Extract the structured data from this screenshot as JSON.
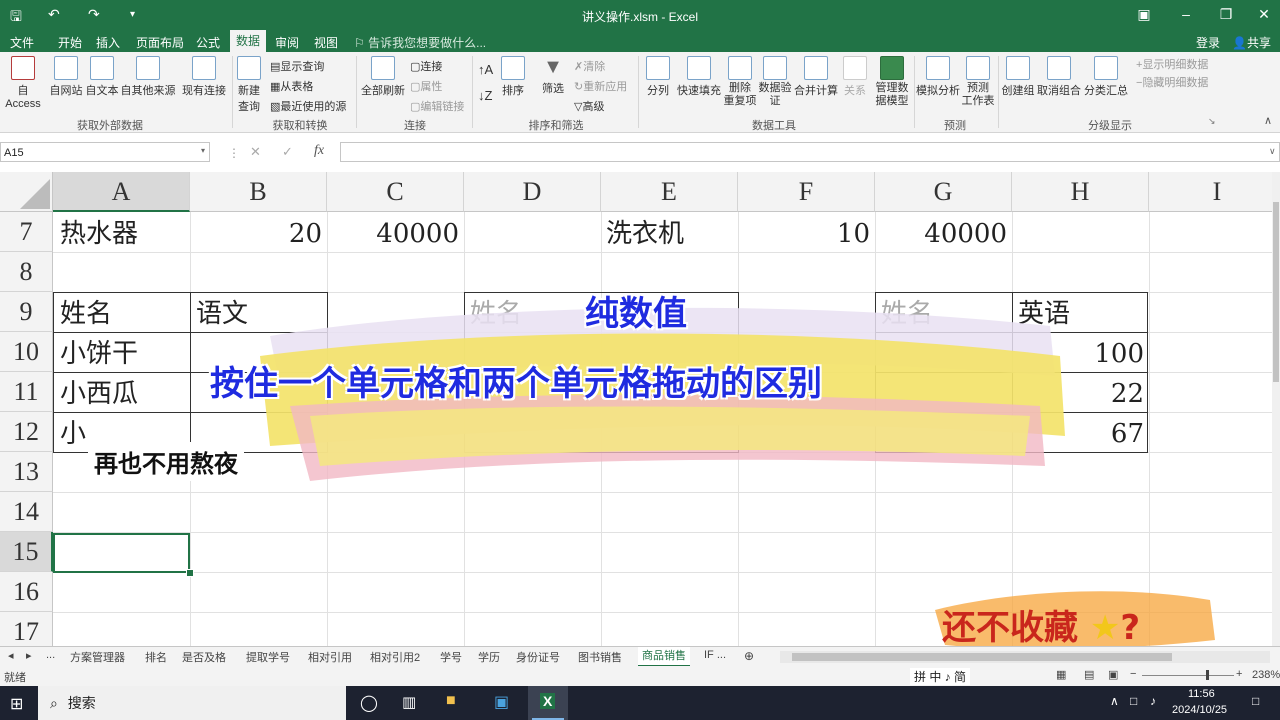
{
  "window": {
    "title": "讲义操作.xlsm - Excel",
    "sign_in": "登录",
    "share": "共享"
  },
  "tabs": [
    "文件",
    "开始",
    "插入",
    "页面布局",
    "公式",
    "数据",
    "审阅",
    "视图"
  ],
  "active_tab": "数据",
  "tell_me": "告诉我您想要做什么...",
  "ribbon": {
    "get_external": {
      "label": "获取外部数据",
      "buttons": [
        "自 Access",
        "自网站",
        "自文本",
        "自其他来源",
        "现有连接"
      ]
    },
    "get_transform": {
      "label": "获取和转换",
      "new_query": "新建\n查询",
      "items": [
        "显示查询",
        "从表格",
        "最近使用的源"
      ]
    },
    "connections": {
      "label": "连接",
      "refresh": "全部刷新",
      "items": [
        "连接",
        "属性",
        "编辑链接"
      ]
    },
    "sort_filter": {
      "label": "排序和筛选",
      "sort": "排序",
      "filter": "筛选",
      "items": [
        "清除",
        "重新应用",
        "高级"
      ]
    },
    "data_tools": {
      "label": "数据工具",
      "buttons": [
        "分列",
        "快速填充",
        "删除\n重复项",
        "数据验\n证",
        "合并计算",
        "关系",
        "管理数\n据模型"
      ]
    },
    "forecast": {
      "label": "预测",
      "buttons": [
        "模拟分析",
        "预测\n工作表"
      ]
    },
    "outline": {
      "label": "分级显示",
      "buttons": [
        "创建组",
        "取消组合",
        "分类汇总"
      ],
      "items": [
        "显示明细数据",
        "隐藏明细数据"
      ]
    }
  },
  "name_box": "A15",
  "formula": "",
  "columns": [
    "A",
    "B",
    "C",
    "D",
    "E",
    "F",
    "G",
    "H",
    "I"
  ],
  "rows": [
    "7",
    "8",
    "9",
    "10",
    "11",
    "12",
    "13",
    "14",
    "15",
    "16",
    "17"
  ],
  "cells": {
    "A7": "热水器",
    "B7": "20",
    "C7": "40000",
    "E7": "洗衣机",
    "F7": "10",
    "G7": "40000",
    "A9": "姓名",
    "B9": "语文",
    "D9": "姓名",
    "G9": "姓名",
    "H9": "英语",
    "A10": "小饼干",
    "H10": "100",
    "A11": "小西瓜",
    "H11": "22",
    "A12": "小",
    "H12": "67"
  },
  "overlay": {
    "line1": "纯数值",
    "line2": "按住一个单元格和两个单元格拖动的区别",
    "caption": "再也不用熬夜",
    "cta": "还不收藏",
    "cta_mark": "?"
  },
  "sheet_tabs": [
    "...",
    "方案管理器",
    "排名",
    "是否及格",
    "提取学号",
    "相对引用",
    "相对引用2",
    "学号",
    "学历",
    "身份证号",
    "图书销售",
    "商品销售",
    "IF ..."
  ],
  "active_sheet": "商品销售",
  "status": {
    "left": "就绪",
    "zoom": "238%",
    "ime": "拼 中 ♪ 简"
  },
  "taskbar": {
    "search": "搜索",
    "time": "11:56",
    "date": "2024/10/25"
  },
  "colors": {
    "excel_green": "#217346",
    "overlay_blue": "#1f2be0",
    "cta_red": "#c9261c"
  }
}
